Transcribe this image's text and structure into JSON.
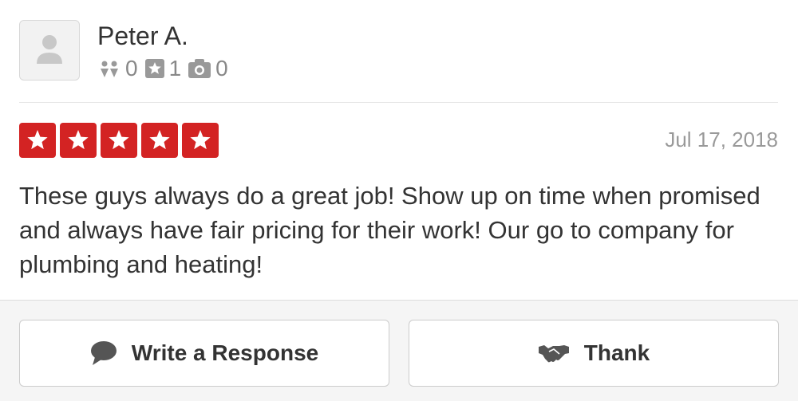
{
  "reviewer": {
    "name": "Peter A.",
    "friends_count": "0",
    "reviews_count": "1",
    "photos_count": "0"
  },
  "review": {
    "rating": 5,
    "rating_max": 5,
    "date": "Jul 17, 2018",
    "text": "These guys always do a great job! Show up on time when promised and always have fair pricing for their work! Our go to company for plumbing and heating!"
  },
  "actions": {
    "write_response_label": "Write a Response",
    "thank_label": "Thank"
  },
  "colors": {
    "star_red": "#d32323",
    "text": "#333333",
    "muted": "#999999"
  },
  "icons": {
    "avatar": "default-user-avatar-icon",
    "friends": "friends-icon",
    "reviews": "star-square-icon",
    "photos": "camera-icon",
    "star": "star-icon",
    "speech": "speech-bubble-icon",
    "thank": "handshake-icon"
  }
}
